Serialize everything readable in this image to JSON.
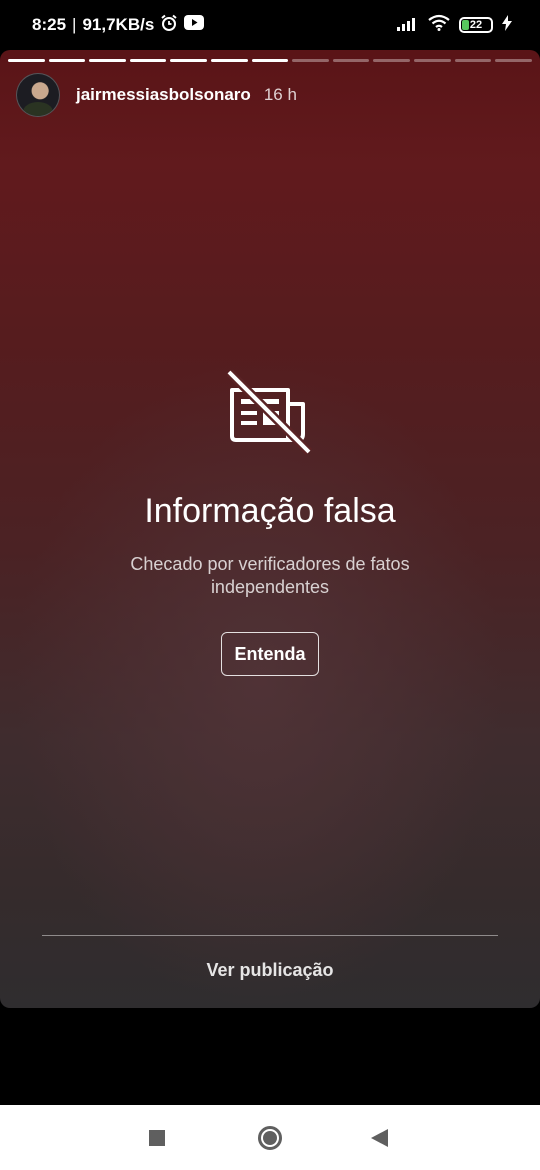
{
  "status_bar": {
    "time": "8:25",
    "separator": "|",
    "network_speed": "91,7KB/s",
    "alarm_icon": "alarm-icon",
    "youtube_icon": "youtube-icon",
    "signal_icon": "signal-icon",
    "wifi_icon": "wifi-icon",
    "battery_percent": "22",
    "battery_fill": 0.22,
    "battery_color": "#58c85e",
    "charging_icon": "charging-bolt-icon"
  },
  "story": {
    "progress": {
      "total_segments": 13,
      "completed_segments": 7
    },
    "username": "jairmessiasbolsonaro",
    "time_ago": "16 h",
    "warning": {
      "icon": "no-newspaper-icon",
      "title": "Informação falsa",
      "subtitle": "Checado por verificadores de fatos independentes",
      "button_label": "Entenda"
    },
    "see_post_label": "Ver publicação"
  },
  "nav_bar": {
    "recents_icon": "square-recents-icon",
    "home_icon": "circle-home-icon",
    "back_icon": "triangle-back-icon"
  },
  "colors": {
    "story_top": "#5a1417",
    "story_bottom": "#2f2d2f",
    "nav_icon": "#5f5f5f"
  }
}
